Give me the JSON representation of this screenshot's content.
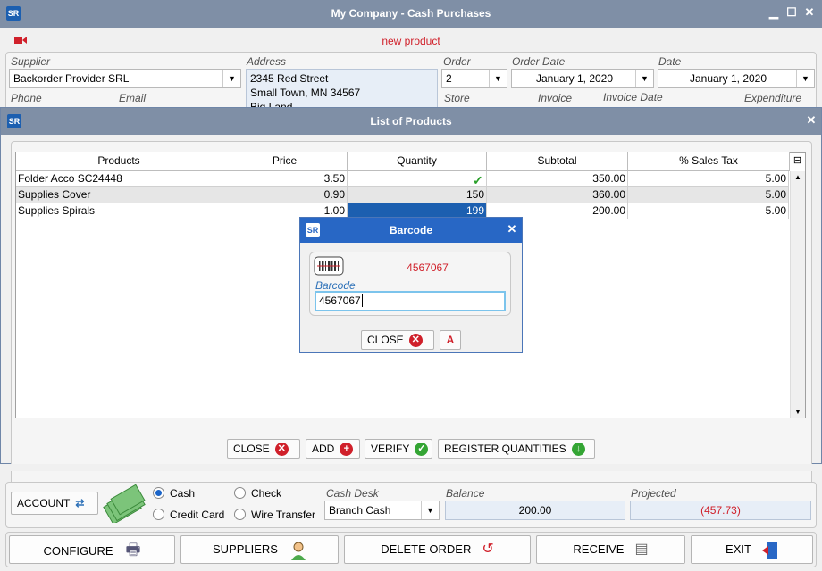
{
  "window": {
    "title": "My Company - Cash Purchases",
    "logo": "SR",
    "status": "new product"
  },
  "header": {
    "supplier_label": "Supplier",
    "supplier_value": "Backorder Provider SRL",
    "address_label": "Address",
    "address_lines": [
      "2345 Red Street",
      "Small Town, MN 34567",
      "Big Land"
    ],
    "order_label": "Order",
    "order_value": "2",
    "order_date_label": "Order Date",
    "order_date_value": "January 1, 2020",
    "date_label": "Date",
    "date_value": "January 1, 2020",
    "phone_label": "Phone",
    "email_label": "Email",
    "store_label": "Store",
    "invoice_label": "Invoice",
    "invoice_date_label": "Invoice Date",
    "expenditure_label": "Expenditure"
  },
  "products_dialog": {
    "title": "List of Products",
    "columns": [
      "Products",
      "Price",
      "Quantity",
      "Subtotal",
      "% Sales Tax"
    ],
    "rows": [
      {
        "product": "Folder Acco SC24448",
        "price": "3.50",
        "quantity": "",
        "subtotal": "350.00",
        "tax": "5.00"
      },
      {
        "product": "Supplies Cover",
        "price": "0.90",
        "quantity": "150",
        "subtotal": "360.00",
        "tax": "5.00"
      },
      {
        "product": "Supplies Spirals",
        "price": "1.00",
        "quantity": "199",
        "subtotal": "200.00",
        "tax": "5.00"
      }
    ],
    "buttons": {
      "close": "CLOSE",
      "add": "ADD",
      "verify": "VERIFY",
      "register": "REGISTER QUANTITIES"
    }
  },
  "barcode_dialog": {
    "title": "Barcode",
    "code_display": "4567067",
    "field_label": "Barcode",
    "field_value": "4567067",
    "close_label": "CLOSE",
    "a_label": "A"
  },
  "payment": {
    "account_label": "ACCOUNT",
    "cash": "Cash",
    "check": "Check",
    "credit_card": "Credit Card",
    "wire_transfer": "Wire Transfer",
    "cash_desk_label": "Cash Desk",
    "cash_desk_value": "Branch Cash",
    "balance_label": "Balance",
    "balance_value": "200.00",
    "projected_label": "Projected",
    "projected_value": "(457.73)"
  },
  "bottom_bar": {
    "configure": "CONFIGURE",
    "suppliers": "SUPPLIERS",
    "delete_order": "DELETE ORDER",
    "receive": "RECEIVE",
    "exit": "EXIT"
  },
  "colors": {
    "title_bg": "#7f8fa6",
    "barcode_title_bg": "#2867c5",
    "accent_red": "#d0202a",
    "accent_green": "#34a534"
  }
}
